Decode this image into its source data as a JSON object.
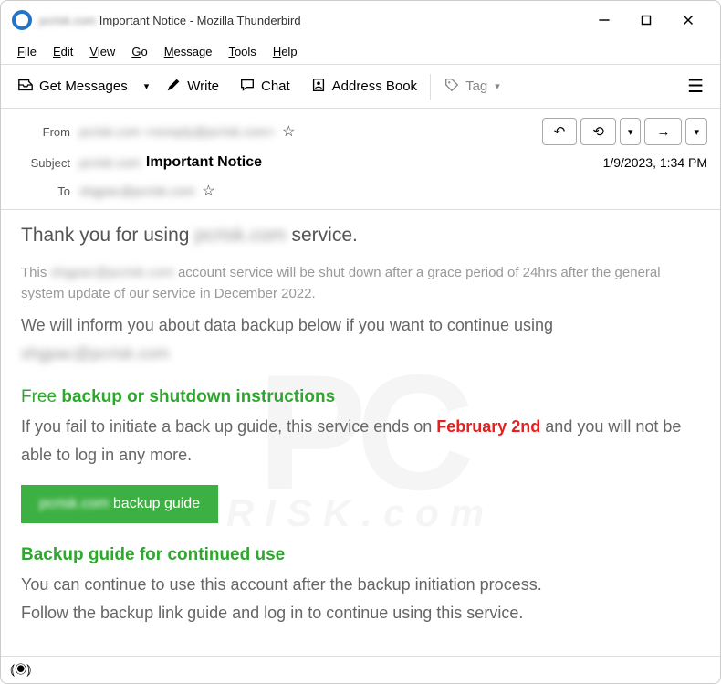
{
  "titlebar": {
    "blurred_prefix": "pcrisk.com",
    "title": "Important Notice - Mozilla Thunderbird"
  },
  "menubar": {
    "file": "File",
    "edit": "Edit",
    "view": "View",
    "go": "Go",
    "message": "Message",
    "tools": "Tools",
    "help": "Help"
  },
  "toolbar": {
    "get": "Get Messages",
    "write": "Write",
    "chat": "Chat",
    "address": "Address Book",
    "tag": "Tag"
  },
  "header": {
    "from_label": "From",
    "from_blur": "pcrisk.com <noreply@pcrisk.com>",
    "subject_label": "Subject",
    "subject_blur": "pcrisk.com",
    "subject_text": "Important Notice",
    "date": "1/9/2023, 1:34 PM",
    "to_label": "To",
    "to_blur": "shgpac@pcrisk.com"
  },
  "body": {
    "greeting_pre": "Thank you for using ",
    "greeting_blur": "pcrisk.com",
    "greeting_post": " service.",
    "notice_pre": "This ",
    "notice_blur": "shgpac@pcrisk.com",
    "notice_post": " account service will be shut down after a grace period of 24hrs after the general system update of our service in December 2022.",
    "inform_pre": "We  will inform you about data backup below if you want to continue using ",
    "inform_blur": "shgpac@pcrisk.com",
    "h1_free": "Free ",
    "h1_bold": "backup or shutdown  instructions",
    "fail_pre": "If you fail to initiate a back up guide, this service ends on ",
    "fail_date": "February 2nd",
    "fail_post": " and you will not be able to log in any more.",
    "cta_blur": "pcrisk.com",
    "cta_text": " backup guide",
    "h2": "Backup guide for continued use",
    "cont1": "You can continue to use this account after the backup initiation process.",
    "cont2": "Follow the backup link guide and log in to continue using this service."
  },
  "watermark": {
    "big": "PC",
    "sub": "RISK.com"
  }
}
